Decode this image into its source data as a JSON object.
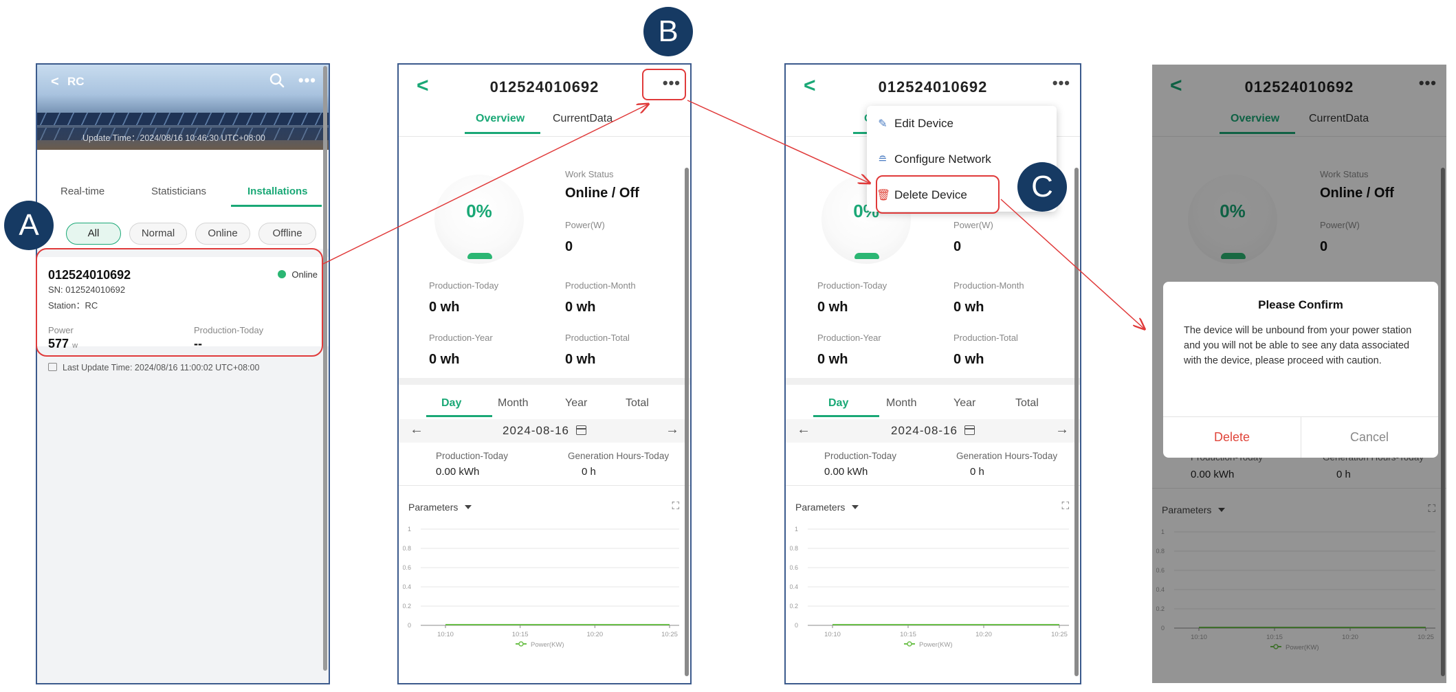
{
  "colors": {
    "accent": "#1aa876",
    "annotation": "#e03a3a",
    "badge": "#163a63",
    "danger": "#e0453a"
  },
  "badges": {
    "a": "A",
    "b": "B",
    "c": "C"
  },
  "phoneA": {
    "back_icon": "chevron-left-icon",
    "title": "RC",
    "update_time": "Update Time：2024/08/16 10:46:30 UTC+08:00",
    "tabs": [
      "Real-time",
      "Statisticians",
      "Installations"
    ],
    "filters": [
      "All",
      "Normal",
      "Online",
      "Offline"
    ],
    "device": {
      "id": "012524010692",
      "status": "Online",
      "sn": "SN: 012524010692",
      "station": "Station：RC",
      "power_label": "Power",
      "power_value": "577",
      "power_unit": "w",
      "production_label": "Production-Today",
      "production_value": "--"
    },
    "last_update": "Last Update Time: 2024/08/16 11:00:02 UTC+08:00"
  },
  "detail": {
    "title": "012524010692",
    "more": "•••",
    "tabs": [
      "Overview",
      "CurrentData"
    ],
    "percent": "0%",
    "work_status_label": "Work Status",
    "work_status_value": "Online / Off",
    "power_label": "Power(W)",
    "power_value": "0",
    "prod_today_label": "Production-Today",
    "prod_today_value": "0 wh",
    "prod_month_label": "Production-Month",
    "prod_month_value": "0 wh",
    "prod_year_label": "Production-Year",
    "prod_year_value": "0 wh",
    "prod_total_label": "Production-Total",
    "prod_total_value": "0 wh",
    "period_tabs": [
      "Day",
      "Month",
      "Year",
      "Total"
    ],
    "date": "2024-08-16",
    "gen_today_label": "Production-Today",
    "gen_today_value": "0.00 kWh",
    "gen_hours_label": "Generation Hours-Today",
    "gen_hours_value": "0 h",
    "parameters_label": "Parameters"
  },
  "menu": {
    "items": [
      {
        "label": "Edit Device",
        "icon": "pencil-icon"
      },
      {
        "label": "Configure Network",
        "icon": "wifi-router-icon"
      },
      {
        "label": "Delete Device",
        "icon": "trash-icon"
      }
    ]
  },
  "dialog": {
    "title": "Please Confirm",
    "body": "The device will be unbound from your power station and you will not be able to see any data associated with the device, please proceed with caution.",
    "delete_label": "Delete",
    "cancel_label": "Cancel"
  },
  "chart_data": {
    "type": "line",
    "x": [
      "10:10",
      "10:15",
      "10:20",
      "10:25"
    ],
    "series": [
      {
        "name": "Power(KW)",
        "values": [
          0,
          0,
          0,
          0
        ]
      }
    ],
    "yticks": [
      "1",
      "0.8",
      "0.6",
      "0.4",
      "0.2",
      "0"
    ],
    "ylim": [
      0,
      1
    ],
    "grid": true,
    "legend": "bottom"
  }
}
